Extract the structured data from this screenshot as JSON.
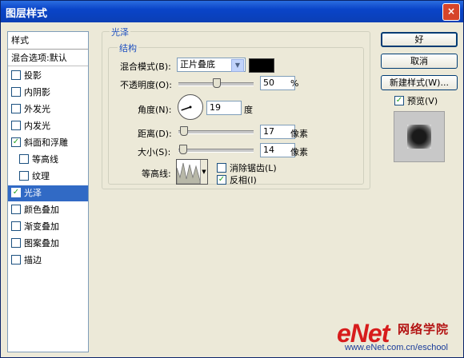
{
  "window": {
    "title": "图层样式",
    "close_glyph": "×"
  },
  "sidebar": {
    "header": "样式",
    "blend_defaults": "混合选项:默认",
    "items": [
      {
        "label": "投影",
        "checked": false
      },
      {
        "label": "内阴影",
        "checked": false
      },
      {
        "label": "外发光",
        "checked": false
      },
      {
        "label": "内发光",
        "checked": false
      },
      {
        "label": "斜面和浮雕",
        "checked": true
      },
      {
        "label": "等高线",
        "checked": false
      },
      {
        "label": "纹理",
        "checked": false
      },
      {
        "label": "光泽",
        "checked": true,
        "selected": true
      },
      {
        "label": "颜色叠加",
        "checked": false
      },
      {
        "label": "渐变叠加",
        "checked": false
      },
      {
        "label": "图案叠加",
        "checked": false
      },
      {
        "label": "描边",
        "checked": false
      }
    ]
  },
  "satin": {
    "group_title": "光泽",
    "structure_title": "结构",
    "blend_mode_label": "混合模式(B):",
    "blend_mode_value": "正片叠底",
    "blend_color": "#000000",
    "opacity_label": "不透明度(O):",
    "opacity_value": "50",
    "opacity_unit": "%",
    "angle_label": "角度(N):",
    "angle_value": "19",
    "angle_unit": "度",
    "distance_label": "距离(D):",
    "distance_value": "17",
    "distance_unit": "像素",
    "size_label": "大小(S):",
    "size_value": "14",
    "size_unit": "像素",
    "contour_label": "等高线:",
    "antialias_label": "消除锯齿(L)",
    "antialias_checked": false,
    "invert_label": "反相(I)",
    "invert_checked": true
  },
  "buttons": {
    "ok": "好",
    "cancel": "取消",
    "new_style": "新建样式(W)...",
    "preview_label": "预览(V)",
    "preview_checked": true
  },
  "watermark": {
    "brand": "eNet",
    "cn": "网络学院",
    "url": "www.eNet.com.cn/eschool"
  }
}
